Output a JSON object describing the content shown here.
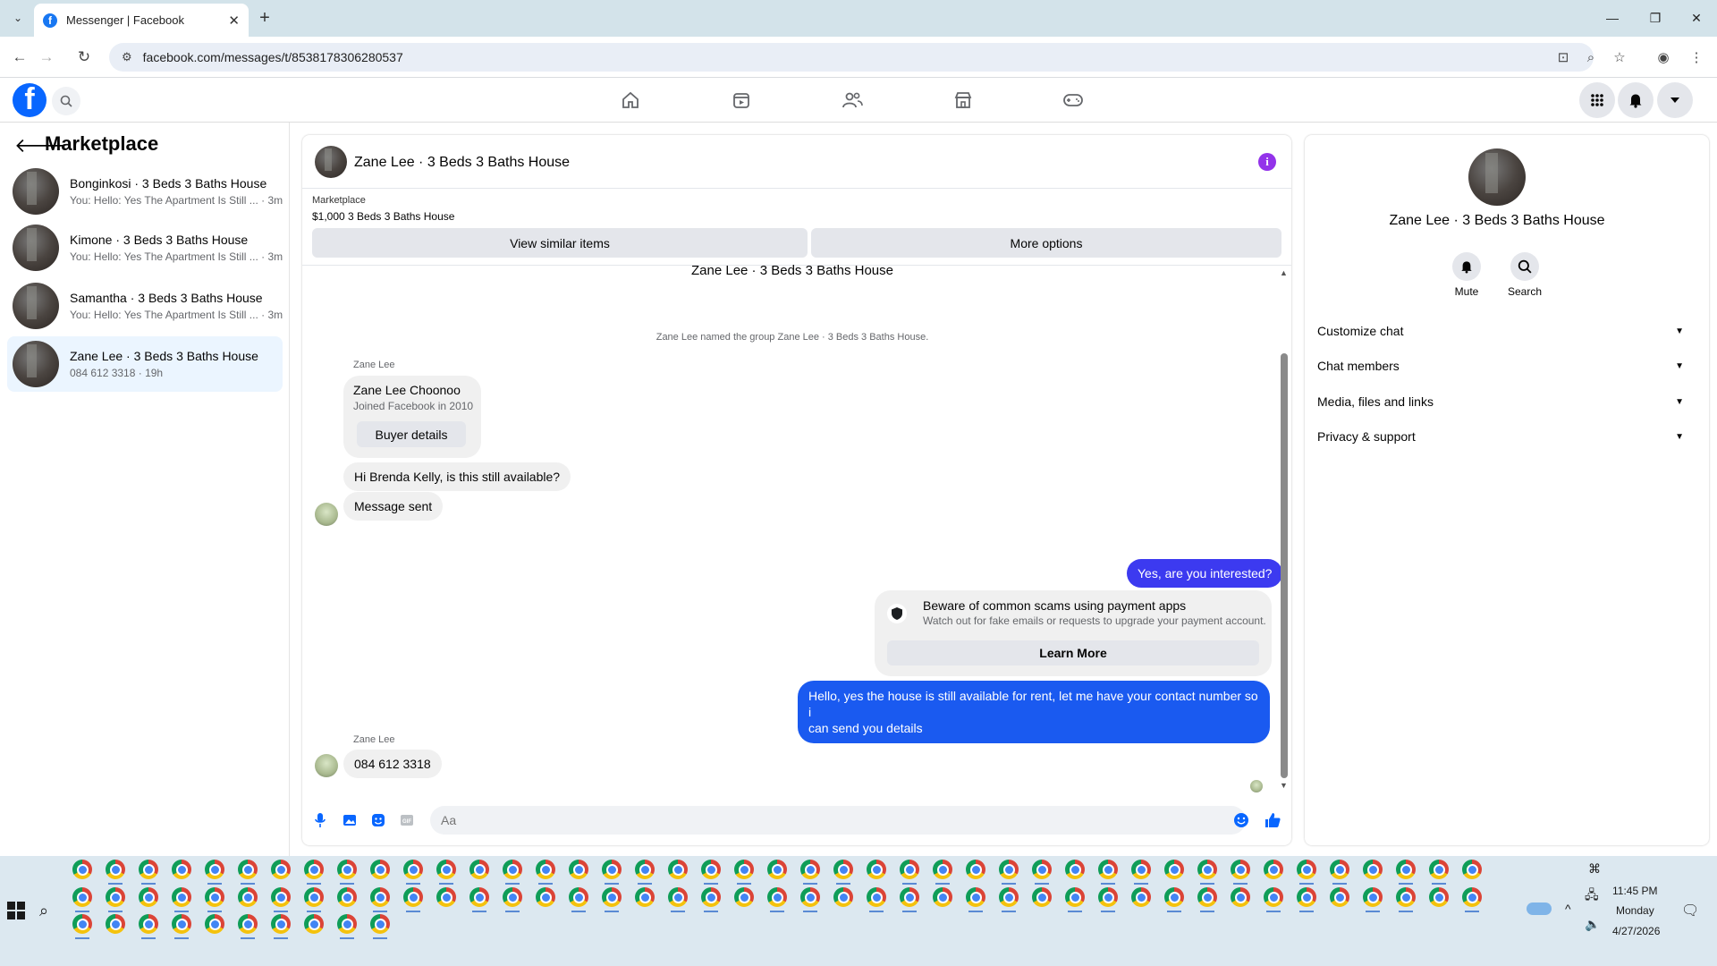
{
  "browser": {
    "tab_title": "Messenger | Facebook",
    "url": "facebook.com/messages/t/8538178306280537",
    "new_tab_symbol": "+",
    "close_symbol": "✕"
  },
  "left": {
    "title": "Marketplace",
    "conversations": [
      {
        "name": "Bonginkosi · 3 Beds 3 Baths House",
        "snippet": "You: Hello: Yes The Apartment Is Still ... · 3m"
      },
      {
        "name": "Kimone · 3 Beds 3 Baths House",
        "snippet": "You: Hello: Yes The Apartment Is Still ... · 3m"
      },
      {
        "name": "Samantha · 3 Beds 3 Baths House",
        "snippet": "You: Hello: Yes The Apartment Is Still ... · 3m"
      },
      {
        "name": "Zane Lee · 3 Beds 3 Baths House",
        "snippet": "084 612 3318 · 19h"
      }
    ]
  },
  "chat": {
    "header_name": "Zane Lee · 3 Beds 3 Baths House",
    "marketplace_label": "Marketplace",
    "listing": "$1,000 3 Beds 3 Baths House",
    "view_similar": "View similar items",
    "more_options": "More options",
    "top_title": "Zane Lee · 3 Beds 3 Baths House",
    "system_msg": "Zane Lee named the group Zane Lee · 3 Beds 3 Baths House.",
    "sender": "Zane Lee",
    "buyer_name": "Zane Lee Choonoo",
    "buyer_joined": "Joined Facebook in 2010",
    "buyer_details": "Buyer details",
    "msg1": "Hi Brenda Kelly, is this still available?",
    "msg2": "Message sent",
    "out1": "Yes, are you interested?",
    "scam_title": "Beware of common scams using payment apps",
    "scam_sub": "Watch out for fake emails or requests to upgrade your payment account.",
    "learn_more": "Learn More",
    "out2_line1": "Hello, yes the house is still available for rent, let me have your contact number so i",
    "out2_line2": "can send you details",
    "sender2": "Zane Lee",
    "msg3": "084 612 3318",
    "composer_placeholder": "Aa"
  },
  "right": {
    "name": "Zane Lee · 3 Beds 3 Baths House",
    "mute": "Mute",
    "search": "Search",
    "sections": [
      "Customize chat",
      "Chat members",
      "Media, files and links",
      "Privacy & support"
    ]
  },
  "taskbar": {
    "time": "11:45 PM",
    "day": "Monday",
    "date": "4/27/2026"
  },
  "colors": {
    "facebook_blue": "#0866ff",
    "outgoing_bubble": "#3c3af0",
    "info_icon": "#9333ea",
    "active_conversation": "#ebf5ff"
  }
}
